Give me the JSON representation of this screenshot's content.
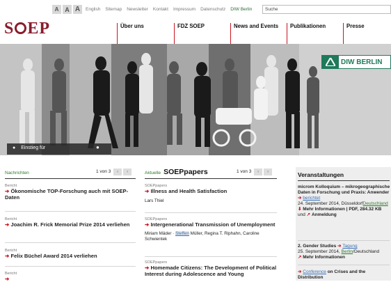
{
  "topbar": {
    "font_sizes": [
      "A",
      "A",
      "A"
    ],
    "links": [
      "English",
      "Sitemap",
      "Newsletter",
      "Kontakt",
      "Impressum",
      "Datenschutz"
    ],
    "diw_link": "DIW Berlin",
    "search_placeholder": "Suche"
  },
  "logo": {
    "left": "S",
    "right": "EP"
  },
  "nav": [
    "Über uns",
    "FDZ SOEP",
    "News and Events",
    "Publikationen",
    "Presse"
  ],
  "hero": {
    "banner_text": "DIW BERLIN",
    "einstieg": "Einstieg für"
  },
  "col1": {
    "title": "Nachrichten",
    "pager": "1 von 3",
    "items": [
      {
        "label": "Bericht",
        "title": "Ökonomische TOP-Forschung auch mit SOEP-Daten"
      },
      {
        "label": "Bericht",
        "title": "Joachim R. Frick Memorial Prize 2014 verliehen"
      },
      {
        "label": "Bericht",
        "title": "Felix Büchel Award 2014 verliehen"
      },
      {
        "label": "Bericht",
        "title": ""
      }
    ]
  },
  "col2": {
    "tab": "Aktuelle",
    "title": "SOEPpapers",
    "pager": "1 von 3",
    "items": [
      {
        "label": "SOEPpapers",
        "title": "Illness and Health Satisfaction",
        "authors_a": "Lars Thiel",
        "authors_hl": "",
        "authors_b": ""
      },
      {
        "label": "SOEPpapers",
        "title": "Intergenerational Transmission of Unemployment",
        "authors_a": "Miriam Mäder · ",
        "authors_hl": "Steffen",
        "authors_b": " Müller, Regina T. Riphahn, Caroline Schwientek"
      },
      {
        "label": "SOEPpapers",
        "title": "Homemade Citizens: The Development of Political Interest during Adolescence and Young",
        "authors_a": "",
        "authors_hl": "",
        "authors_b": ""
      }
    ]
  },
  "col3": {
    "title": "Veranstaltungen",
    "event1": {
      "title": "microm Kolloquium – mikrogeographische Daten in Forschung und Praxis: Anwender",
      "link": "berichtet",
      "date_place": "24. September 2014, Düsseldorf",
      "country": "Deutschland",
      "more": "Mehr Informationen | PDF, 284.32 KB",
      "und": "und",
      "register": "Anmeldung"
    },
    "event2": {
      "title": "2. Gender Studies",
      "link": "Tagung",
      "date": "25. September 2014,",
      "city": "Berlin",
      "country": "/Deutschland",
      "more": "Mehr Informationen"
    },
    "event3": {
      "link": "Conference",
      "title": "on Crises and the Distribution"
    }
  }
}
